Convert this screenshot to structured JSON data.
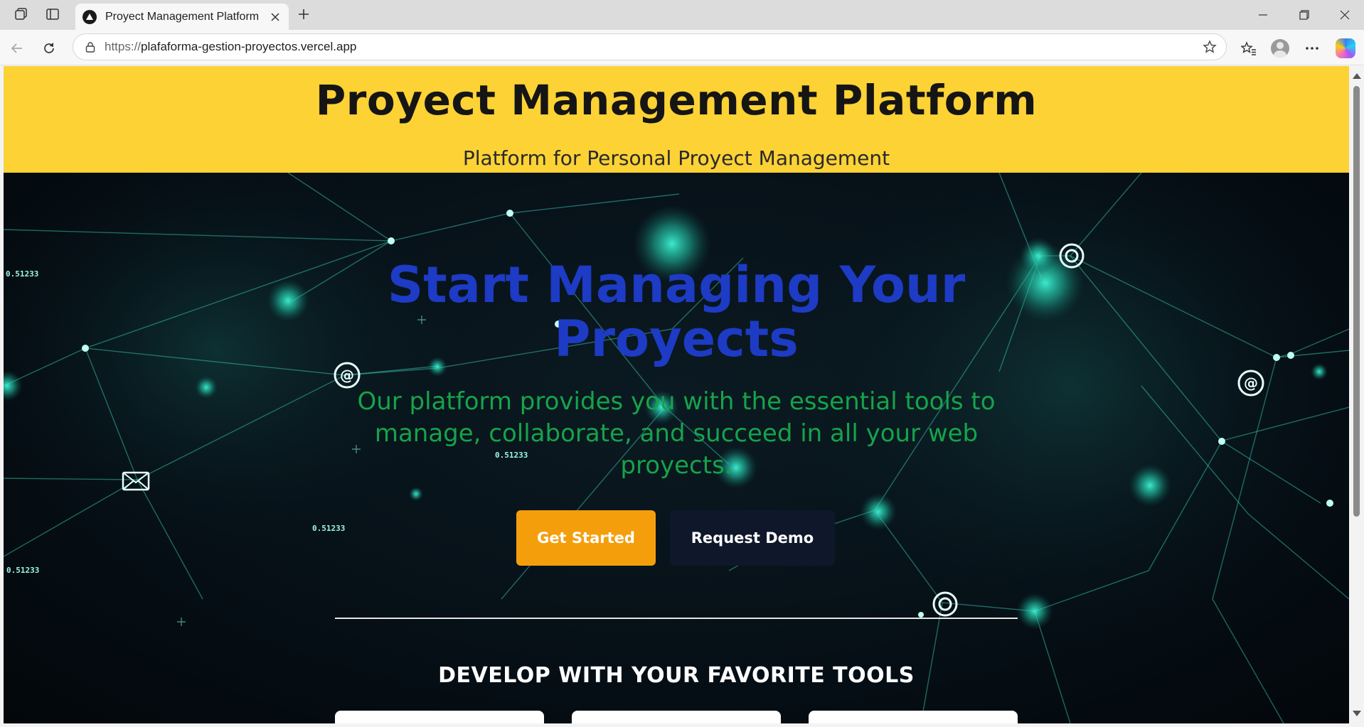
{
  "browser": {
    "tab_title": "Proyect Management Platform",
    "url_protocol": "https://",
    "url_host": "plafaforma-gestion-proyectos.vercel.app",
    "icons": [
      "workspaces-icon",
      "vertical-tabs-icon",
      "tab-favicon-icon",
      "close-icon",
      "plus-icon",
      "minimize-icon",
      "restore-icon",
      "window-close-icon",
      "back-icon",
      "reload-icon",
      "lock-icon",
      "star-icon",
      "favorites-icon",
      "profile-avatar",
      "more-icon",
      "copilot-icon"
    ]
  },
  "header": {
    "title": "Proyect Management Platform",
    "subtitle": "Platform for Personal Proyect Management",
    "background_color": "#fdd235"
  },
  "hero": {
    "heading": "Start Managing Your Proyects",
    "description": "Our platform provides you with the essential tools to manage, collaborate, and succeed in all your web proyects.",
    "primary_button": "Get Started",
    "secondary_button": "Request Demo",
    "heading_color": "#1d3bc4",
    "description_color": "#16a34a",
    "primary_color": "#f59e0b",
    "secondary_color": "#0f172a",
    "bg_labels": [
      "0.51233",
      "0.51233",
      "0.51233",
      "0.51233"
    ]
  },
  "tools": {
    "title": "DEVELOP WITH YOUR FAVORITE TOOLS"
  }
}
